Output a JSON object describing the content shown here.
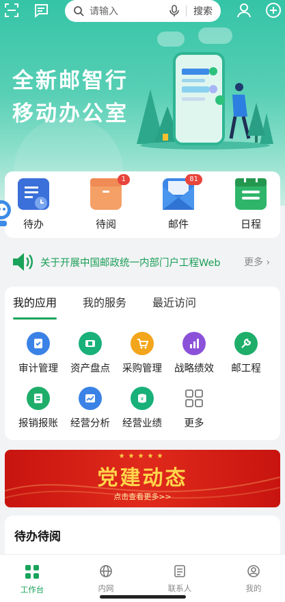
{
  "search": {
    "placeholder": "请输入",
    "button": "搜索"
  },
  "hero": {
    "line1": "全新邮智行",
    "line2": "移动办公室"
  },
  "quick": [
    {
      "label": "待办",
      "icon": "todo-doc-icon",
      "badge": null
    },
    {
      "label": "待阅",
      "icon": "box-icon",
      "badge": "1"
    },
    {
      "label": "邮件",
      "icon": "mail-icon",
      "badge": "81"
    },
    {
      "label": "日程",
      "icon": "calendar-icon",
      "badge": null
    }
  ],
  "notice": {
    "text": "关于开展中国邮政统一内部门户工程Web",
    "more": "更多"
  },
  "apps": {
    "tabs": [
      "我的应用",
      "我的服务",
      "最近访问"
    ],
    "items": [
      {
        "label": "审计管理",
        "icon": "audit-icon",
        "color": "#3b82e6"
      },
      {
        "label": "资产盘点",
        "icon": "asset-icon",
        "color": "#19b07a"
      },
      {
        "label": "采购管理",
        "icon": "cart-icon",
        "color": "#f3a51b"
      },
      {
        "label": "战略绩效",
        "icon": "chart-bar-icon",
        "color": "#8b52d9"
      },
      {
        "label": "邮工程",
        "icon": "wrench-icon",
        "color": "#1fae6a"
      },
      {
        "label": "报销报账",
        "icon": "reimburse-icon",
        "color": "#1fae6a"
      },
      {
        "label": "经营分析",
        "icon": "trend-icon",
        "color": "#3b82e6"
      },
      {
        "label": "经营业绩",
        "icon": "coins-icon",
        "color": "#19b07a"
      },
      {
        "label": "更多",
        "icon": "more-grid-icon",
        "color": "#888888"
      }
    ]
  },
  "banner": {
    "title": "党建动态",
    "subtitle": "点击查看更多>>"
  },
  "todo": {
    "title": "待办待阅"
  },
  "tabbar": [
    {
      "label": "工作台",
      "icon": "workbench-icon",
      "active": true
    },
    {
      "label": "内网",
      "icon": "globe-icon",
      "active": false
    },
    {
      "label": "联系人",
      "icon": "contacts-icon",
      "active": false
    },
    {
      "label": "我的",
      "icon": "profile-icon",
      "active": false
    }
  ]
}
